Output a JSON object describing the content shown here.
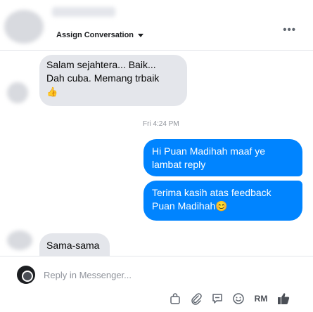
{
  "header": {
    "assign_label": "Assign Conversation",
    "more_label": "•••"
  },
  "messages": {
    "incoming_1": {
      "line1": "Salam sejahtera... Baik...",
      "line2": "Dah cuba. Memang trbaik",
      "emoji": "👍"
    },
    "timestamp": "Fri 4:24 PM",
    "outgoing_1": {
      "line1": "Hi Puan Madihah maaf ye",
      "line2": "lambat reply"
    },
    "outgoing_2": {
      "line1": "Terima kasih atas feedback",
      "line2": "Puan Madihah😊"
    },
    "incoming_2": {
      "text": "Sama-sama"
    }
  },
  "composer": {
    "placeholder": "Reply in Messenger...",
    "rm_label": "RM"
  },
  "icons": [
    "bag-icon",
    "paperclip-icon",
    "saved-reply-icon",
    "emoji-icon",
    "thumbs-up-icon"
  ],
  "colors": {
    "outgoing_bubble": "#0084ff",
    "incoming_bubble": "#e4e6eb"
  }
}
